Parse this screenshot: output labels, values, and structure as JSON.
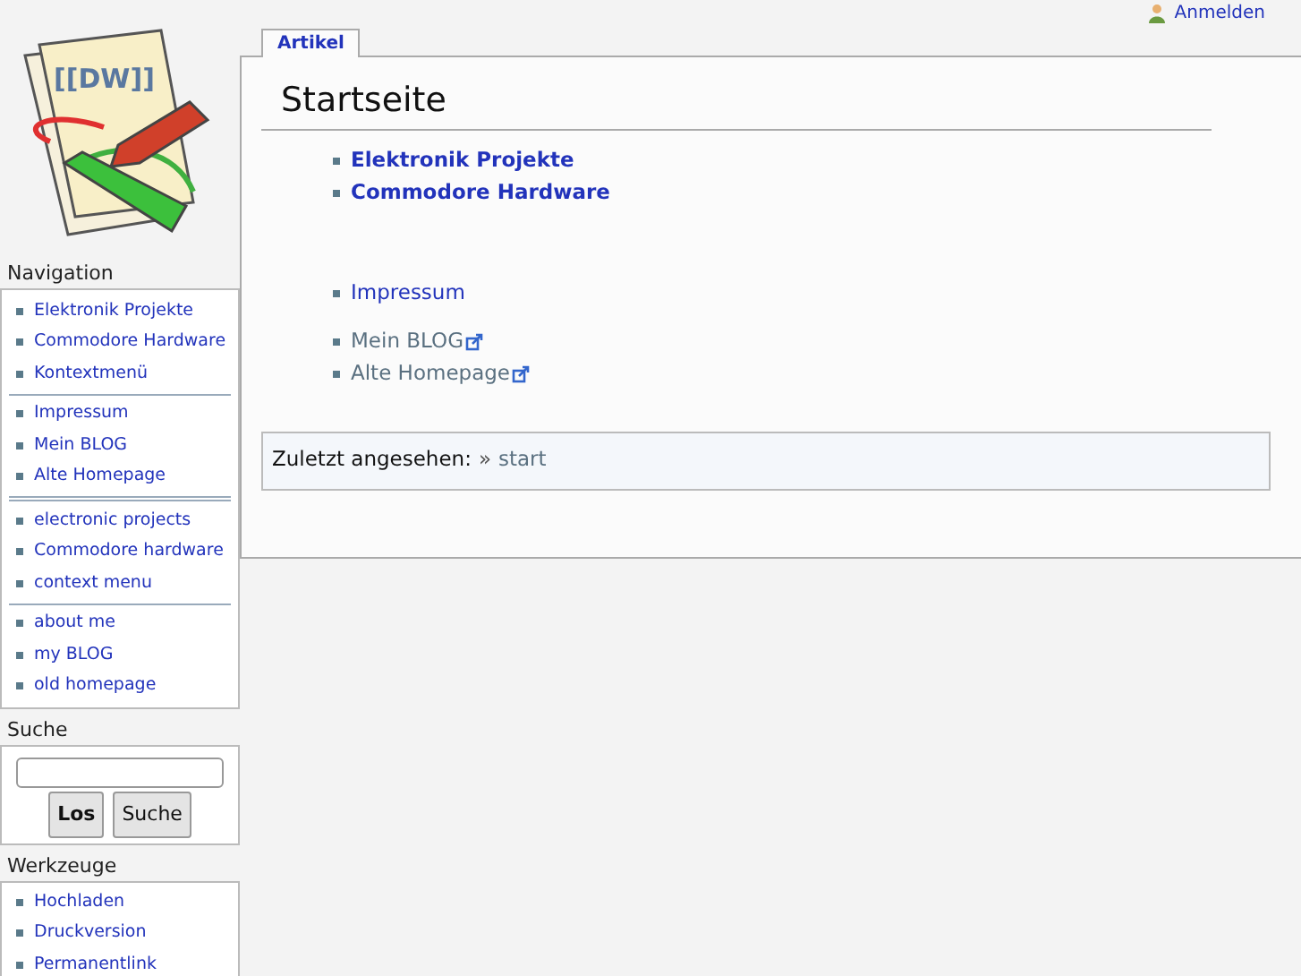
{
  "logo_text": "[[DW]]",
  "user_link": "Anmelden",
  "tabs": [
    {
      "label": "Artikel",
      "selected": true
    }
  ],
  "page_title": "Startseite",
  "content_groups": [
    [
      {
        "text": "Elektronik Projekte",
        "bold": true,
        "kind": "internal"
      },
      {
        "text": "Commodore Hardware",
        "bold": true,
        "kind": "internal"
      }
    ],
    [
      {
        "text": "Impressum",
        "bold": false,
        "kind": "internal"
      }
    ],
    [
      {
        "text": "Mein BLOG",
        "bold": false,
        "kind": "external"
      },
      {
        "text": "Alte Homepage",
        "bold": false,
        "kind": "external"
      }
    ]
  ],
  "breadcrumb": {
    "label": "Zuletzt angesehen:",
    "separator": "»",
    "link": "start"
  },
  "sidebar": {
    "navigation": {
      "heading": "Navigation",
      "groups": [
        {
          "rule_after": true,
          "double_rule": false,
          "items": [
            "Elektronik Projekte",
            "Commodore Hardware",
            "Kontextmenü"
          ]
        },
        {
          "rule_after": true,
          "double_rule": true,
          "items": [
            "Impressum",
            "Mein BLOG",
            "Alte Homepage"
          ]
        },
        {
          "rule_after": true,
          "double_rule": false,
          "items": [
            "electronic projects",
            "Commodore hardware",
            "context menu"
          ]
        },
        {
          "rule_after": false,
          "items": [
            "about me",
            "my BLOG",
            "old homepage"
          ]
        }
      ]
    },
    "search": {
      "heading": "Suche",
      "buttons": [
        {
          "label": "Los",
          "bold": true
        },
        {
          "label": "Suche",
          "bold": false
        }
      ]
    },
    "tools": {
      "heading": "Werkzeuge",
      "items": [
        "Hochladen",
        "Druckversion",
        "Permanentlink"
      ]
    }
  }
}
